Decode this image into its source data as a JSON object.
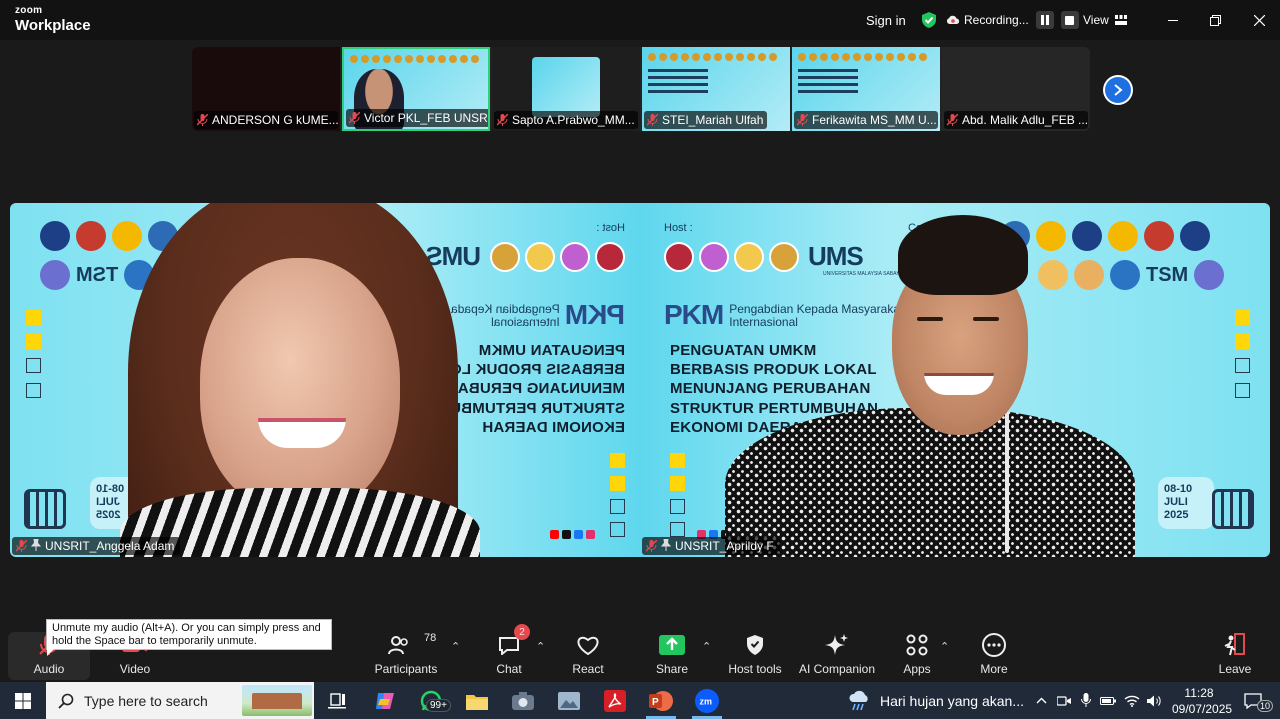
{
  "titlebar": {
    "brand_top": "zoom",
    "brand_bottom": "Workplace",
    "sign_in": "Sign in",
    "recording": "Recording...",
    "view": "View"
  },
  "gallery": {
    "tiles": [
      {
        "name": "ANDERSON G kUME..."
      },
      {
        "name": "Victor PKL_FEB UNSR..."
      },
      {
        "name": "Sapto A.Prabwo_MM..."
      },
      {
        "name": "STEI_Mariah Ulfah"
      },
      {
        "name": "Ferikawita MS_MM U..."
      },
      {
        "name": "Abd. Malik Adlu_FEB ..."
      }
    ]
  },
  "stage": {
    "left_name": "UNSRIT_Anggela Adam",
    "right_name": "UNSRIT_Aprildy F",
    "banner": {
      "host_label": "Host :",
      "ums": "UMS",
      "ums_sub": "UNIVERSITAS MALAYSIA SABAH",
      "co_label": "Co",
      "pkm": "PKM",
      "pkm_line1": "Pengabdian Kepada Masyarakat",
      "pkm_line2": "Internasional",
      "headline": [
        "PENGUATAN UMKM",
        "BERBASIS PRODUK LOKAL",
        "MENUNJANG PERUBAHAN",
        "STRUKTUR PERTUMBUHAN",
        "EKONOMI DAERAH"
      ],
      "left_logo_text": "TSM",
      "date_line1": "08-10",
      "date_line2": "JULI",
      "date_line3": "2025"
    }
  },
  "toolbar": {
    "audio": "Audio",
    "video": "Video",
    "participants": "Participants",
    "participant_count": "78",
    "chat": "Chat",
    "chat_badge": "2",
    "react": "React",
    "share": "Share",
    "host_tools": "Host tools",
    "ai_companion": "AI Companion",
    "apps": "Apps",
    "more": "More",
    "leave": "Leave",
    "tooltip": "Unmute my audio (Alt+A). Or you can simply press and hold the Space bar to temporarily unmute."
  },
  "taskbar": {
    "search_placeholder": "Type here to search",
    "whatsapp_badge": "99+",
    "weather": "Hari hujan yang akan...",
    "time": "11:28",
    "date": "09/07/2025",
    "notif_count": "10"
  },
  "colors": {
    "zoom_blue": "#0b5cff",
    "share_green": "#22c55e",
    "badge_red": "#e5484d",
    "banner_cyan": "#5fd7ee",
    "banner_yellow": "#ffd60a"
  }
}
